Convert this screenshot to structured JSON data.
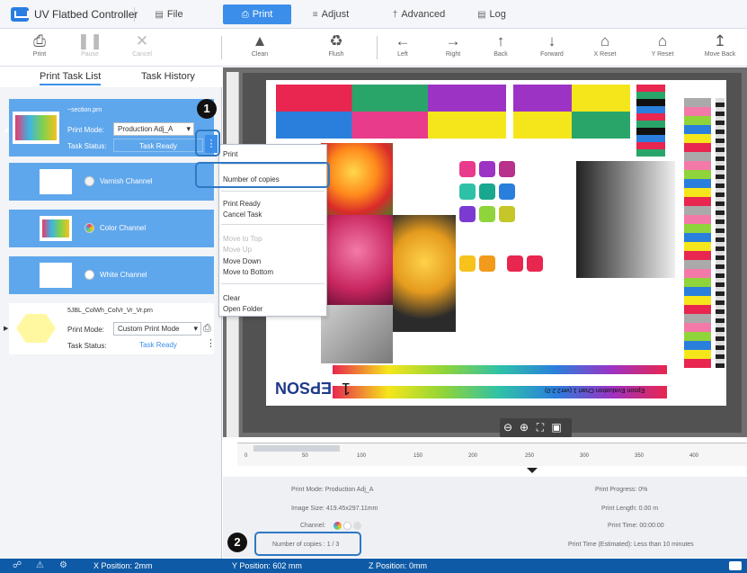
{
  "app": {
    "title": "UV Flatbed Controller"
  },
  "menu": {
    "file": "File",
    "print": "Print",
    "adjust": "Adjust",
    "advanced": "Advanced",
    "log": "Log"
  },
  "toolbar": {
    "print": "Print",
    "pause": "Pause",
    "cancel": "Cancel",
    "clean": "Clean",
    "flush": "Flush",
    "left": "Left",
    "right": "Right",
    "back": "Back",
    "forward": "Forward",
    "x_reset": "X Reset",
    "y_reset": "Y Reset",
    "move_back": "Move Back"
  },
  "tabs": {
    "task_list": "Print Task List",
    "task_history": "Task History"
  },
  "task1": {
    "filename": "~section.prn",
    "print_mode_label": "Print Mode:",
    "print_mode_value": "Production Adj_A",
    "task_status_label": "Task Status:",
    "task_status_value": "Task Ready"
  },
  "channels": {
    "varnish": "Varnish Channel",
    "color": "Color Channel",
    "white": "White Channel"
  },
  "task2": {
    "filename": "5JBL_ColWh_ColVr_Vr_Vr.prn",
    "print_mode_label": "Print Mode:",
    "print_mode_value": "Custom Print Mode",
    "task_status_label": "Task Status:",
    "task_status_value": "Task Ready"
  },
  "context_menu": {
    "print": "Print",
    "number_of_copies": "Number of copies",
    "print_ready": "Print Ready",
    "cancel_task": "Cancel Task",
    "move_to_top": "Move to Top",
    "move_up": "Move Up",
    "move_down": "Move Down",
    "move_to_bottom": "Move to Bottom",
    "clear": "Clear",
    "open_folder": "Open Folder"
  },
  "callouts": {
    "one": "1",
    "two": "2"
  },
  "ruler": {
    "ticks": [
      "0",
      "50",
      "100",
      "150",
      "200",
      "250",
      "300",
      "350",
      "400"
    ]
  },
  "info": {
    "print_mode": "Print Mode: Production Adj_A",
    "image_size": "Image Size: 419.45x297.11mm",
    "channel": "Channel:",
    "copies": "Number of copies : 1 / 3",
    "progress": "Print Progress: 0%",
    "length": "Print Length: 0.00 m",
    "time": "Print Time: 00:00:00",
    "estimated": "Print Time (Estimated): Less than 10 minutes"
  },
  "status": {
    "x": "X Position: 2mm",
    "y": "Y Position: 602 mm",
    "z": "Z Position: 0mm"
  },
  "paper": {
    "brand": "EPSON",
    "chart_title": "Epson Evaluation Chart 1 (ver2.2.0)",
    "big_numeral": "1"
  },
  "colors": {
    "accent": "#3b8eea",
    "selected_row": "#5fa7ec",
    "status_bar": "#0e5aa7"
  }
}
